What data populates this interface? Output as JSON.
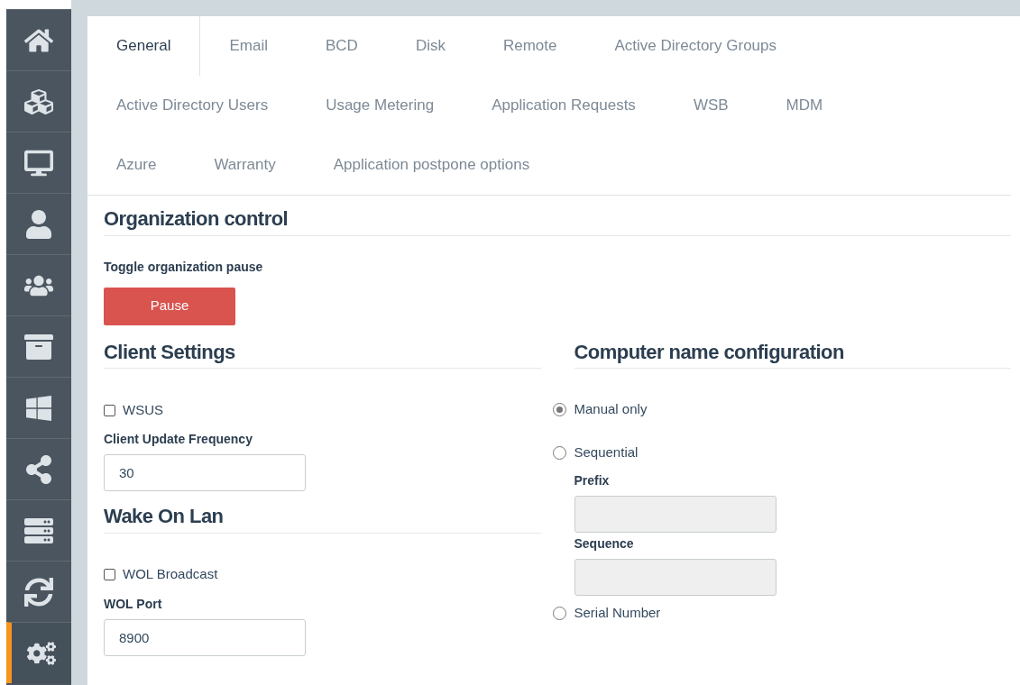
{
  "sidebar": {
    "items": [
      {
        "selected": false
      },
      {
        "selected": false
      },
      {
        "selected": false
      },
      {
        "selected": false
      },
      {
        "selected": false
      },
      {
        "selected": false
      },
      {
        "selected": false
      },
      {
        "selected": false
      },
      {
        "selected": false
      },
      {
        "selected": false
      },
      {
        "selected": true
      }
    ]
  },
  "tab_rows": [
    [
      {
        "label": "General",
        "selected": true
      },
      {
        "label": "Email",
        "selected": false
      },
      {
        "label": "BCD",
        "selected": false
      },
      {
        "label": "Disk",
        "selected": false
      },
      {
        "label": "Remote",
        "selected": false
      },
      {
        "label": "Active Directory Groups",
        "selected": false
      }
    ],
    [
      {
        "label": "Active Directory Users",
        "selected": false
      },
      {
        "label": "Usage Metering",
        "selected": false
      },
      {
        "label": "Application Requests",
        "selected": false
      },
      {
        "label": "WSB",
        "selected": false
      },
      {
        "label": "MDM",
        "selected": false
      }
    ],
    [
      {
        "label": "Azure",
        "selected": false
      },
      {
        "label": "Warranty",
        "selected": false
      },
      {
        "label": "Application postpone options",
        "selected": false
      }
    ]
  ],
  "organization_control": {
    "title": "Organization control",
    "label": "Toggle organization pause",
    "button": "Pause"
  },
  "client_settings": {
    "title": "Client Settings",
    "wsus": {
      "label": "WSUS",
      "checked": false
    },
    "frequency": {
      "label": "Client Update Frequency",
      "value": "30"
    }
  },
  "wake_on_lan": {
    "title": "Wake On Lan",
    "broadcast": {
      "label": "WOL Broadcast",
      "checked": false
    },
    "port": {
      "label": "WOL Port",
      "value": "8900"
    }
  },
  "computer_name": {
    "title": "Computer name configuration",
    "options": [
      {
        "label": "Manual only",
        "selected": true
      },
      {
        "label": "Sequential",
        "selected": false
      },
      {
        "label": "Serial Number",
        "selected": false
      }
    ],
    "prefix": {
      "label": "Prefix",
      "disabled": true
    },
    "sequence": {
      "label": "Sequence",
      "disabled": true
    }
  }
}
